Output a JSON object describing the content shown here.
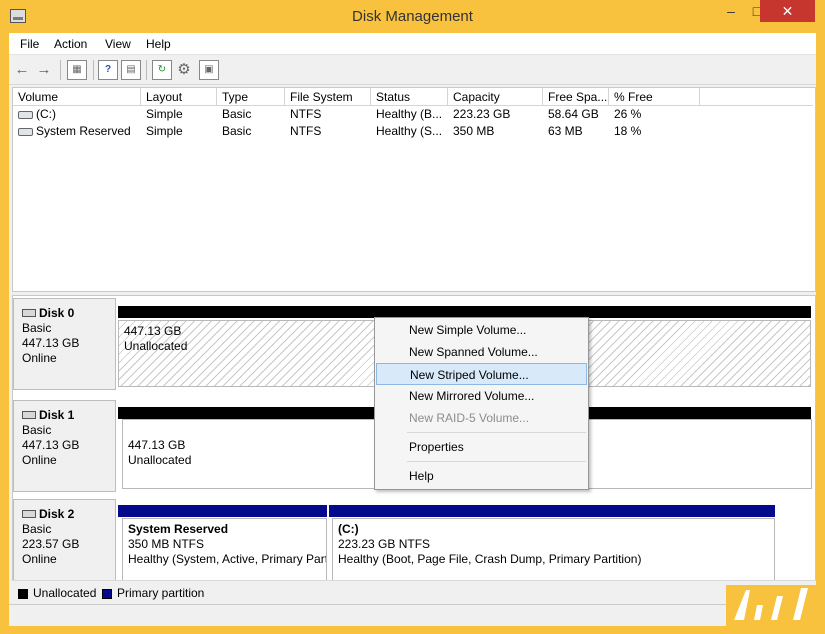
{
  "window": {
    "title": "Disk Management"
  },
  "menu": {
    "items": [
      "File",
      "Action",
      "View",
      "Help"
    ]
  },
  "toolbar": {
    "icons": [
      "back-icon",
      "forward-icon",
      "properties-icon",
      "help-icon",
      "console-icon",
      "rescan-icon",
      "settings-icon",
      "disk-icon"
    ]
  },
  "volume_list": {
    "columns": [
      "Volume",
      "Layout",
      "Type",
      "File System",
      "Status",
      "Capacity",
      "Free Spa...",
      "% Free"
    ],
    "rows": [
      [
        "(C:)",
        "Simple",
        "Basic",
        "NTFS",
        "Healthy (B...",
        "223.23 GB",
        "58.64 GB",
        "26 %"
      ],
      [
        "System Reserved",
        "Simple",
        "Basic",
        "NTFS",
        "Healthy (S...",
        "350 MB",
        "63 MB",
        "18 %"
      ]
    ]
  },
  "disks": [
    {
      "name": "Disk 0",
      "type": "Basic",
      "size": "447.13 GB",
      "status": "Online",
      "partitions": [
        {
          "size": "447.13 GB",
          "label": "Unallocated"
        }
      ]
    },
    {
      "name": "Disk 1",
      "type": "Basic",
      "size": "447.13 GB",
      "status": "Online",
      "partitions": [
        {
          "size": "447.13 GB",
          "label": "Unallocated"
        }
      ]
    },
    {
      "name": "Disk 2",
      "type": "Basic",
      "size": "223.57 GB",
      "status": "Online",
      "partitions": [
        {
          "title": "System Reserved",
          "size": "350 MB NTFS",
          "status": "Healthy (System, Active, Primary Part"
        },
        {
          "title": "(C:)",
          "size": "223.23 GB NTFS",
          "status": "Healthy (Boot, Page File, Crash Dump, Primary Partition)"
        }
      ]
    }
  ],
  "legend": {
    "unallocated": "Unallocated",
    "primary": "Primary partition",
    "colors": {
      "unallocated": "#000000",
      "primary": "#050a8d"
    }
  },
  "context_menu": {
    "items": [
      "New Simple Volume...",
      "New Spanned Volume...",
      "New Striped Volume...",
      "New Mirrored Volume...",
      "New RAID-5 Volume...",
      "Properties",
      "Help"
    ],
    "highlighted": "New Striped Volume...",
    "disabled": "New RAID-5 Volume..."
  },
  "colors": {
    "window_border": "#f8c13e",
    "selection": "#d8eaf9"
  }
}
